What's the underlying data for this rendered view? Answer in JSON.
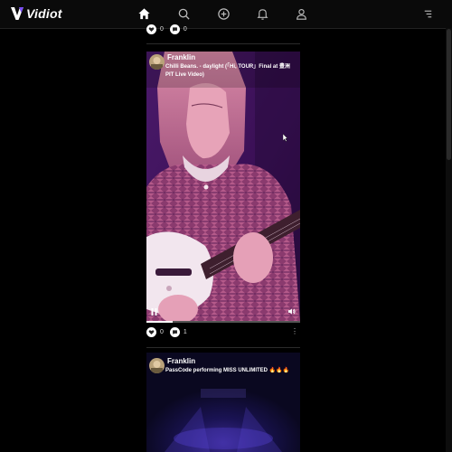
{
  "app": {
    "name": "Vidiot"
  },
  "nav": [
    "home-icon",
    "search-icon",
    "add-icon",
    "bell-icon",
    "user-icon",
    "menu-icon"
  ],
  "colors": {
    "bar": "#0a0a0a",
    "accent": "#ffffff",
    "video_tint": "#7a2a8a"
  },
  "posts": [
    {
      "likes": "0",
      "comments": "0"
    },
    {
      "username": "Franklin",
      "caption": "Chilli Beans. - daylight (「Hi, TOUR」Final at 豊洲PIT Live Video)",
      "likes": "0",
      "comments": "1",
      "progress": 0.17
    },
    {
      "username": "Franklin",
      "caption": "PassCode performing MISS UNLIMITED 🔥🔥🔥"
    }
  ]
}
